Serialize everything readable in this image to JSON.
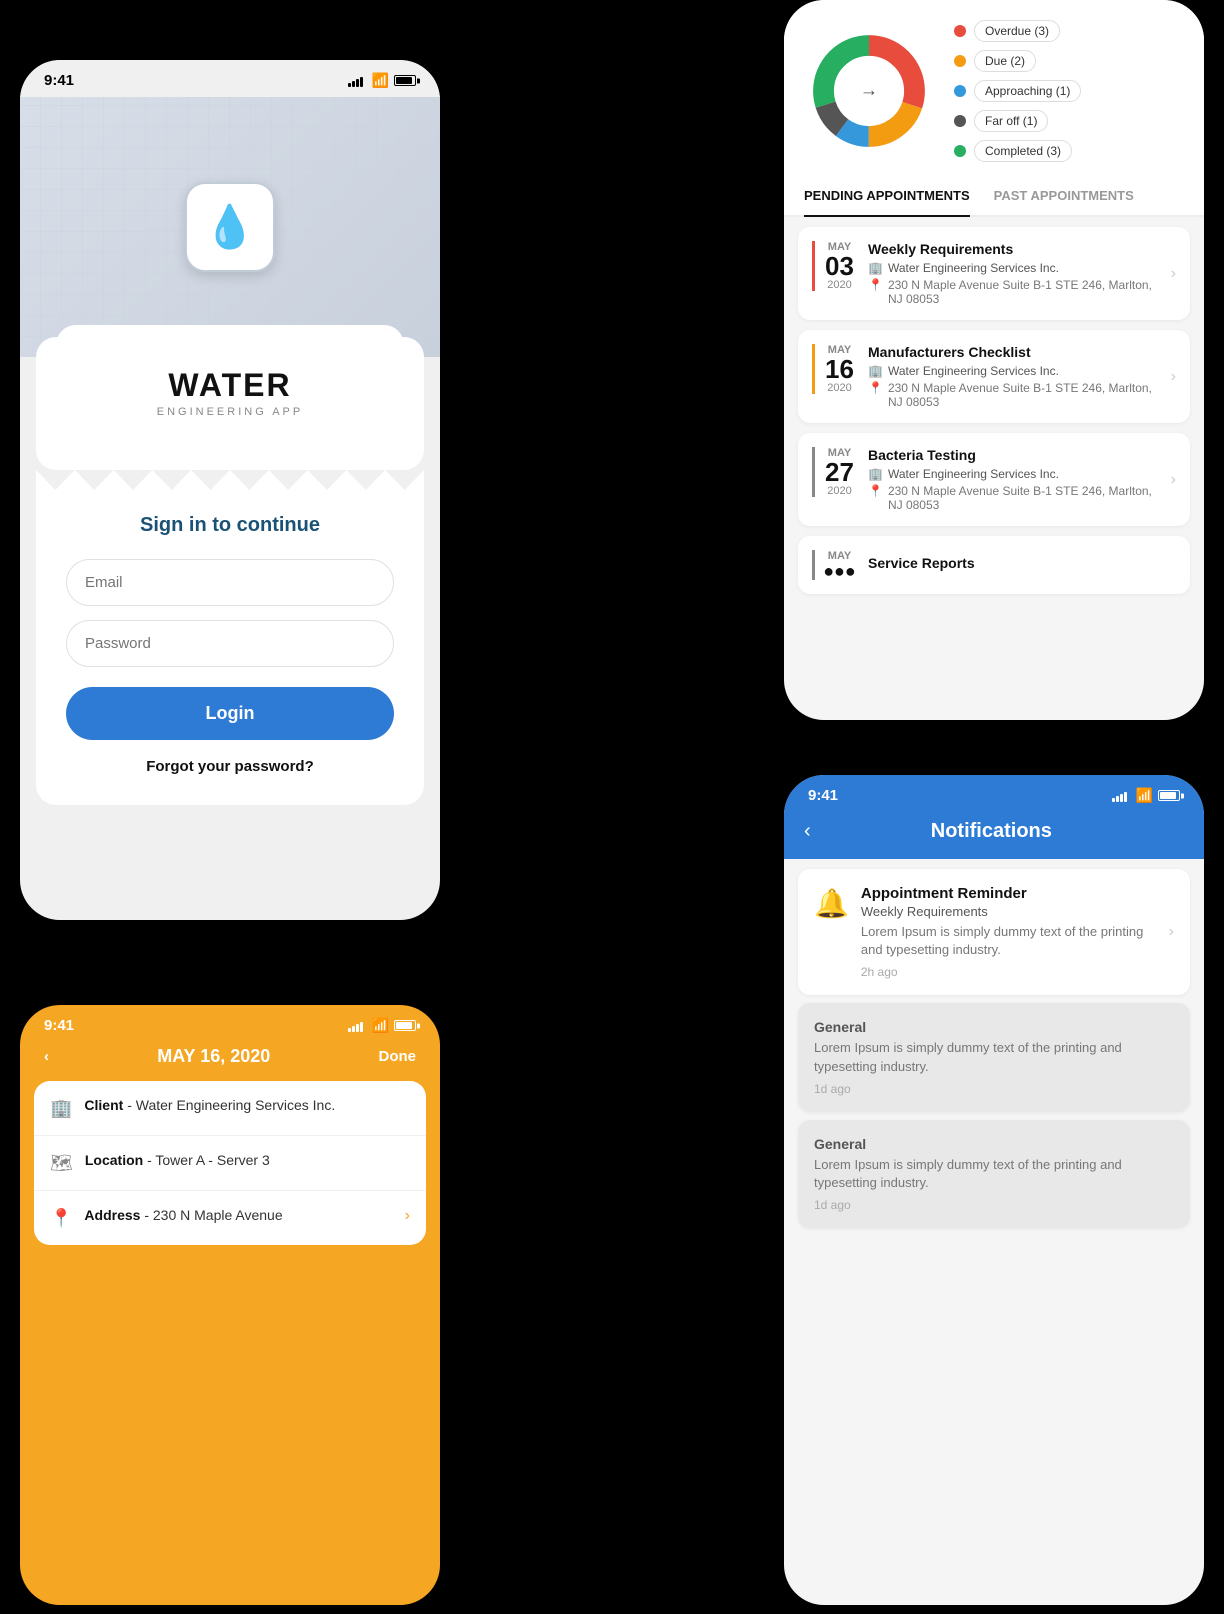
{
  "login": {
    "status_time": "9:41",
    "app_title": "WATER",
    "app_subtitle": "ENGINEERING APP",
    "signin_title": "Sign in to continue",
    "email_placeholder": "Email",
    "password_placeholder": "Password",
    "login_button": "Login",
    "forgot_password": "Forgot your password?"
  },
  "appointments": {
    "chart": {
      "segments": [
        {
          "label": "Overdue (3)",
          "color": "#e74c3c",
          "value": 3
        },
        {
          "label": "Due (2)",
          "color": "#f39c12",
          "value": 2
        },
        {
          "label": "Approaching (1)",
          "color": "#3498db",
          "value": 1
        },
        {
          "label": "Far off (1)",
          "color": "#555",
          "value": 1
        },
        {
          "label": "Completed (3)",
          "color": "#27ae60",
          "value": 3
        }
      ]
    },
    "tabs": [
      {
        "label": "PENDING APPOINTMENTS",
        "active": true
      },
      {
        "label": "PAST APPOINTMENTS",
        "active": false
      }
    ],
    "items": [
      {
        "month": "MAY",
        "day": "03",
        "year": "2020",
        "color": "red",
        "title": "Weekly Requirements",
        "company": "Water Engineering Services Inc.",
        "address": "230 N Maple Avenue Suite B-1 STE 246, Marlton, NJ 08053"
      },
      {
        "month": "MAY",
        "day": "16",
        "year": "2020",
        "color": "orange",
        "title": "Manufacturers Checklist",
        "company": "Water Engineering Services Inc.",
        "address": "230 N Maple Avenue Suite B-1 STE 246, Marlton, NJ 08053"
      },
      {
        "month": "MAY",
        "day": "27",
        "year": "2020",
        "color": "gray",
        "title": "Bacteria Testing",
        "company": "Water Engineering Services Inc.",
        "address": "230 N Maple Avenue Suite B-1 STE 246, Marlton, NJ 08053"
      },
      {
        "month": "MAY",
        "day": "...",
        "year": "",
        "color": "gray",
        "title": "Service Reports",
        "company": "",
        "address": ""
      }
    ]
  },
  "detail": {
    "status_time": "9:41",
    "date_title": "MAY 16, 2020",
    "done_label": "Done",
    "rows": [
      {
        "icon": "building",
        "label": "Client",
        "value": "Water Engineering Services Inc."
      },
      {
        "icon": "map",
        "label": "Location",
        "value": "Tower A - Server 3"
      },
      {
        "icon": "pin",
        "label": "Address",
        "value": "230 N Maple Avenue"
      }
    ]
  },
  "notifications": {
    "status_time": "9:41",
    "screen_title": "Notifications",
    "items": [
      {
        "type": "reminder",
        "icon": "🔔",
        "title": "Appointment Reminder",
        "subtitle": "Weekly Requirements",
        "body": "Lorem Ipsum is simply dummy text of the printing and typesetting industry.",
        "time": "2h ago",
        "white": true
      },
      {
        "type": "general",
        "icon": null,
        "title": "General",
        "subtitle": null,
        "body": "Lorem Ipsum is simply dummy text of the printing and typesetting industry.",
        "time": "1d ago",
        "white": false
      },
      {
        "type": "general",
        "icon": null,
        "title": "General",
        "subtitle": null,
        "body": "Lorem Ipsum is simply dummy text of the printing and typesetting industry.",
        "time": "1d ago",
        "white": false
      }
    ]
  }
}
